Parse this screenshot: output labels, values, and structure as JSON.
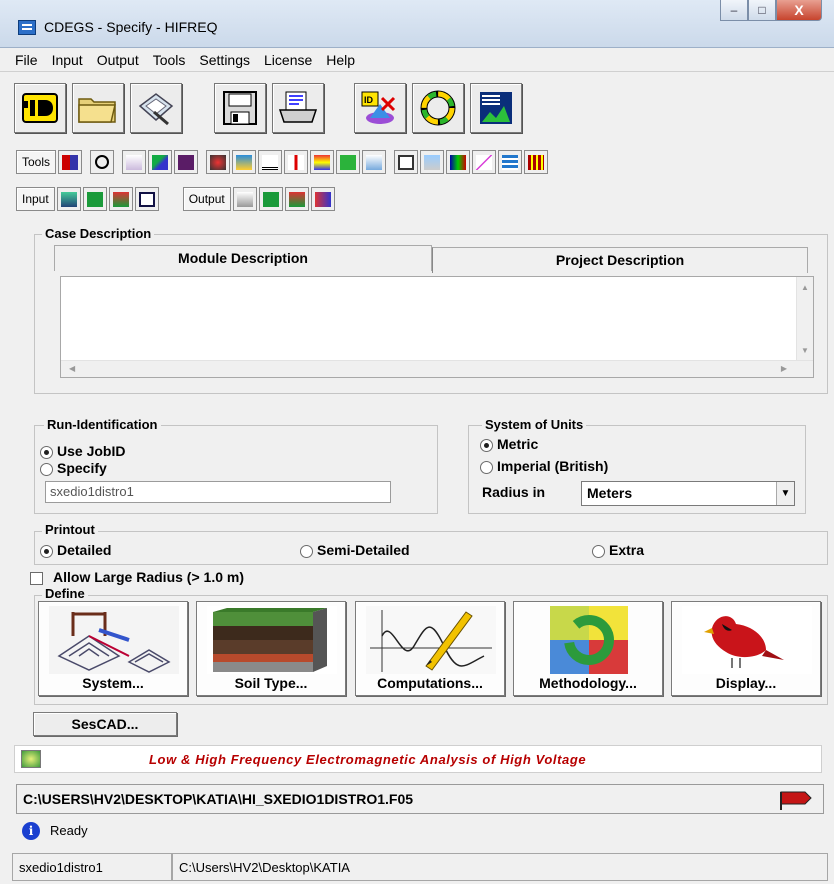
{
  "window": {
    "title": "CDEGS - Specify - HIFREQ",
    "minimize": "–",
    "maximize": "□",
    "close": "X"
  },
  "menu": [
    "File",
    "Input",
    "Output",
    "Tools",
    "Settings",
    "License",
    "Help"
  ],
  "toolbar": {
    "big_icons": [
      "id-card-icon",
      "open-folder-icon",
      "edit-icon",
      "save-disk-icon",
      "print-icon",
      "plot-id-icon",
      "cycle-icon",
      "graph-icon"
    ],
    "tools_label": "Tools",
    "input_label": "Input",
    "output_label": "Output"
  },
  "case_description": {
    "title": "Case Description",
    "tabs": [
      "Module Description",
      "Project Description"
    ],
    "text": ""
  },
  "run_identification": {
    "title": "Run-Identification",
    "options": [
      "Use JobID",
      "Specify"
    ],
    "selected": "Use JobID",
    "value": "sxedio1distro1"
  },
  "units": {
    "title": "System of Units",
    "options": [
      "Metric",
      "Imperial (British)"
    ],
    "selected": "Metric",
    "radius_label": "Radius in",
    "radius_value": "Meters"
  },
  "printout": {
    "title": "Printout",
    "options": [
      "Detailed",
      "Semi-Detailed",
      "Extra"
    ],
    "selected": "Detailed"
  },
  "allow_large_radius": {
    "label": "Allow Large Radius (> 1.0 m)",
    "checked": false
  },
  "define": {
    "title": "Define",
    "buttons": [
      "System...",
      "Soil Type...",
      "Computations...",
      "Methodology...",
      "Display..."
    ]
  },
  "sescad_label": "SesCAD...",
  "banner_text": "Low & High Frequency Electromagnetic Analysis of High Voltage",
  "file_path": "C:\\USERS\\HV2\\DESKTOP\\KATIA\\HI_SXEDIO1DISTRO1.F05",
  "status_text": "Ready",
  "statusbar": {
    "job": "sxedio1distro1",
    "dir": "C:\\Users\\HV2\\Desktop\\KATIA"
  }
}
